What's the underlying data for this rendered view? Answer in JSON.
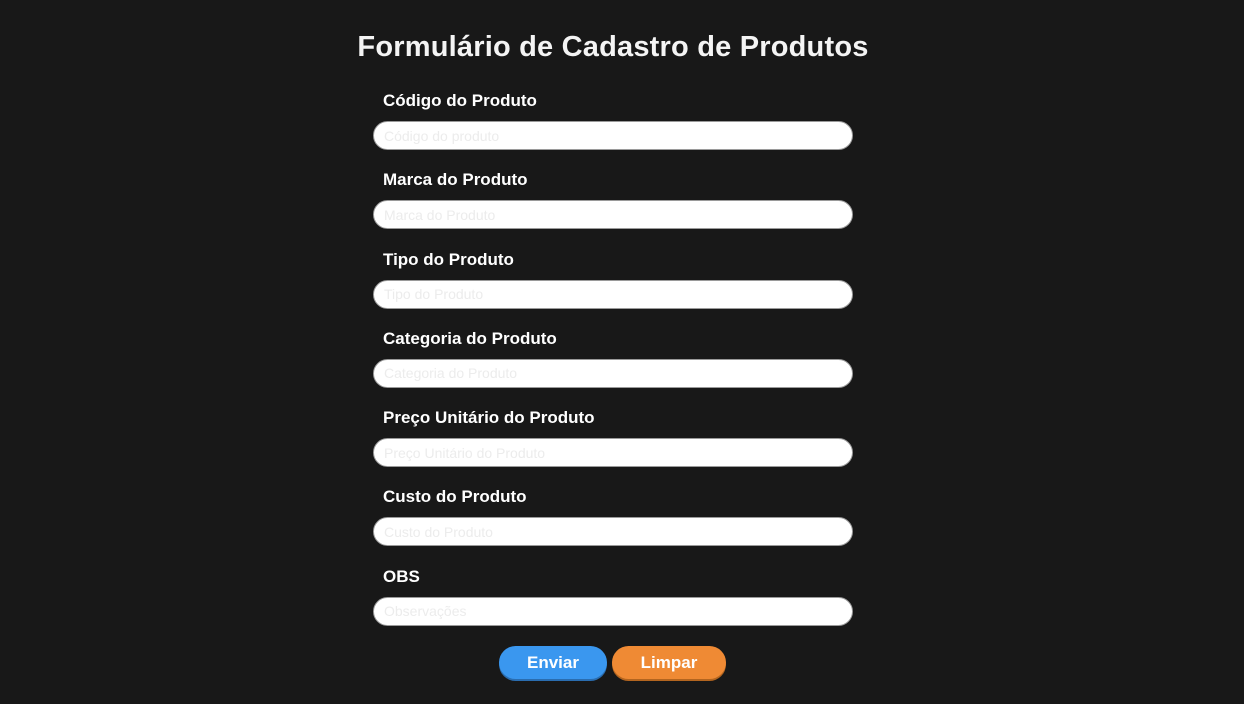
{
  "page": {
    "title": "Formulário de Cadastro de Produtos"
  },
  "form": {
    "fields": [
      {
        "label": "Código do Produto",
        "placeholder": "Código do produto",
        "value": ""
      },
      {
        "label": "Marca do Produto",
        "placeholder": "Marca do Produto",
        "value": ""
      },
      {
        "label": "Tipo do Produto",
        "placeholder": "Tipo do Produto",
        "value": ""
      },
      {
        "label": "Categoria do Produto",
        "placeholder": "Categoria do Produto",
        "value": ""
      },
      {
        "label": "Preço Unitário do Produto",
        "placeholder": "Preço Unitário do Produto",
        "value": ""
      },
      {
        "label": "Custo do Produto",
        "placeholder": "Custo do Produto",
        "value": ""
      },
      {
        "label": "OBS",
        "placeholder": "Observações",
        "value": ""
      }
    ],
    "buttons": {
      "submit_label": "Enviar",
      "clear_label": "Limpar"
    }
  },
  "colors": {
    "background": "#181818",
    "submit_button": "#3a97ef",
    "clear_button": "#ef8a34",
    "input_background": "#ffffff"
  }
}
